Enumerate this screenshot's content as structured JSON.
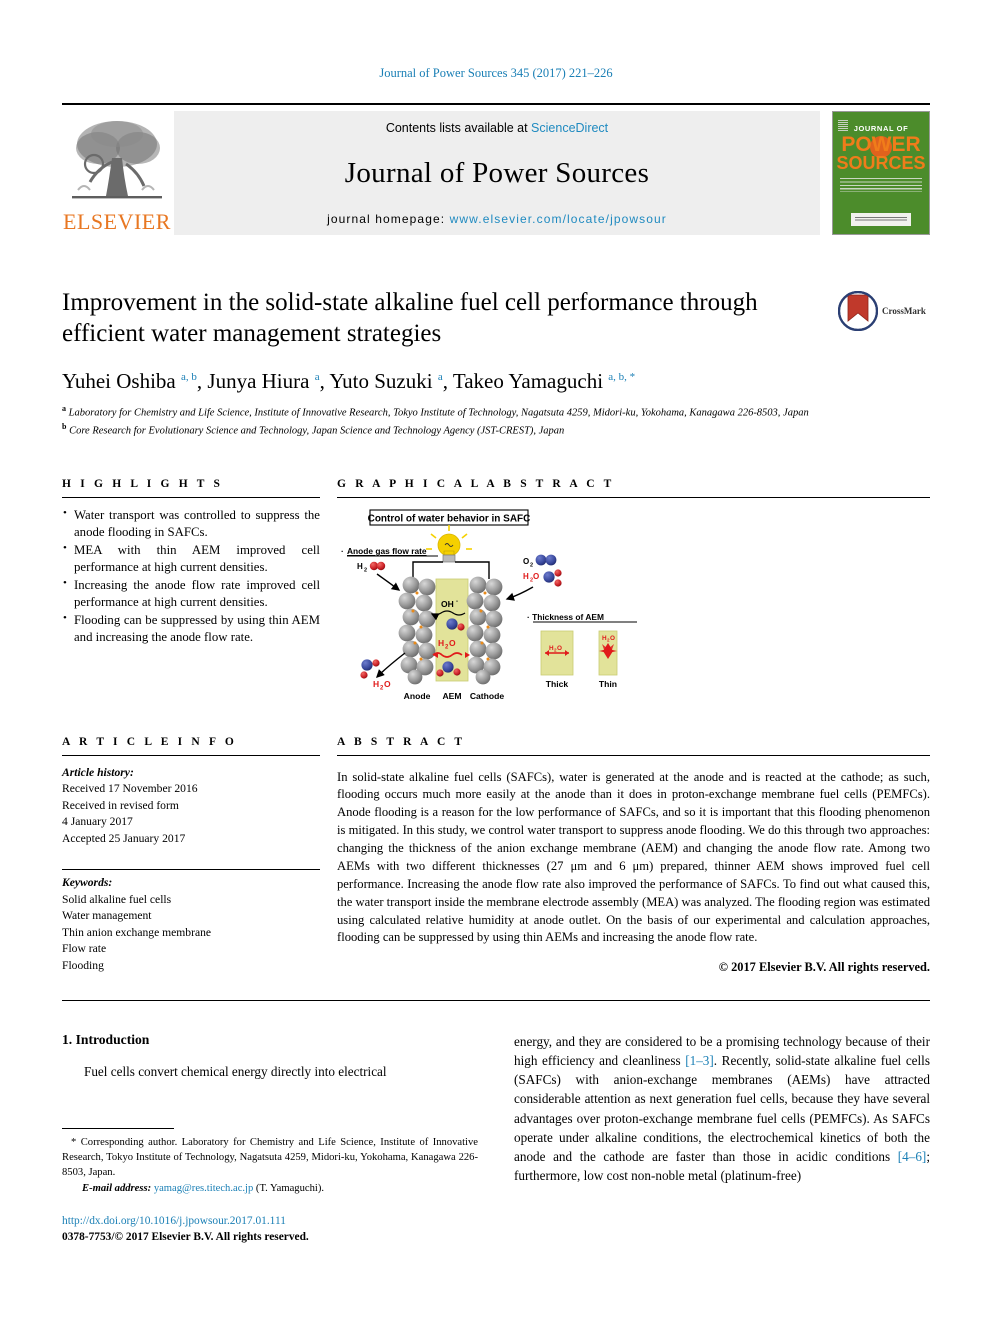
{
  "running_head": "Journal of Power Sources 345 (2017) 221–226",
  "masthead": {
    "publisher_name": "ELSEVIER",
    "contents_prefix": "Contents lists available at ",
    "contents_link": "ScienceDirect",
    "journal_name": "Journal of Power Sources",
    "homepage_prefix": "journal homepage: ",
    "homepage_url": "www.elsevier.com/locate/jpowsour",
    "cover": {
      "line1": "JOURNAL OF",
      "line2": "POWER",
      "line3": "SOURCES",
      "bg_color": "#4c8c2b",
      "accent_color": "#f07c1a"
    }
  },
  "title": "Improvement in the solid-state alkaline fuel cell performance through efficient water management strategies",
  "crossmark_label": "CrossMark",
  "authors": [
    {
      "name": "Yuhei Oshiba",
      "marks": "a, b",
      "sep": ", "
    },
    {
      "name": "Junya Hiura",
      "marks": "a",
      "sep": ", "
    },
    {
      "name": "Yuto Suzuki",
      "marks": "a",
      "sep": ", "
    },
    {
      "name": "Takeo Yamaguchi",
      "marks": "a, b, *",
      "sep": ""
    }
  ],
  "affiliations": [
    {
      "mark": "a",
      "text": "Laboratory for Chemistry and Life Science, Institute of Innovative Research, Tokyo Institute of Technology, Nagatsuta 4259, Midori-ku, Yokohama, Kanagawa 226-8503, Japan"
    },
    {
      "mark": "b",
      "text": "Core Research for Evolutionary Science and Technology, Japan Science and Technology Agency (JST-CREST), Japan"
    }
  ],
  "highlights": {
    "heading": "H I G H L I G H T S",
    "items": [
      "Water transport was controlled to suppress the anode flooding in SAFCs.",
      "MEA with thin AEM improved cell performance at high current densities.",
      "Increasing the anode flow rate improved cell performance at high current densities.",
      "Flooding can be suppressed by using thin AEM and increasing the anode flow rate."
    ]
  },
  "graphical_abstract": {
    "heading": "G R A P H I C A L   A B S T R A C T",
    "figure_title": "Control of water behavior in SAFC",
    "label_anode_flow": "· Anode gas flow rate",
    "label_thickness": "· Thickness of AEM",
    "label_h2": "H₂",
    "label_o2": "O₂",
    "label_h2o": "H₂O",
    "label_oh": "OH⁻",
    "label_anode": "Anode",
    "label_aem": "AEM",
    "label_cathode": "Cathode",
    "label_thick": "Thick",
    "label_thin": "Thin",
    "colors": {
      "membrane": "#e2e39a",
      "particle": "#9a9a9a",
      "oxygen_atom": "#3b4a9c",
      "hydrogen_atom": "#cc2026",
      "water_text": "#e01b1b",
      "bulb": "#f5d000"
    }
  },
  "article_info": {
    "heading": "A R T I C L E   I N F O",
    "history_label": "Article history:",
    "history_lines": [
      "Received 17 November 2016",
      "Received in revised form",
      "4 January 2017",
      "Accepted 25 January 2017"
    ],
    "keywords_label": "Keywords:",
    "keywords": [
      "Solid alkaline fuel cells",
      "Water management",
      "Thin anion exchange membrane",
      "Flow rate",
      "Flooding"
    ]
  },
  "abstract": {
    "heading": "A B S T R A C T",
    "text": "In solid-state alkaline fuel cells (SAFCs), water is generated at the anode and is reacted at the cathode; as such, flooding occurs much more easily at the anode than it does in proton-exchange membrane fuel cells (PEMFCs). Anode flooding is a reason for the low performance of SAFCs, and so it is important that this flooding phenomenon is mitigated. In this study, we control water transport to suppress anode flooding. We do this through two approaches: changing the thickness of the anion exchange membrane (AEM) and changing the anode flow rate. Among two AEMs with two different thicknesses (27 μm and 6 μm) prepared, thinner AEM shows improved fuel cell performance. Increasing the anode flow rate also improved the performance of SAFCs. To find out what caused this, the water transport inside the membrane electrode assembly (MEA) was analyzed. The flooding region was estimated using calculated relative humidity at anode outlet. On the basis of our experimental and calculation approaches, flooding can be suppressed by using thin AEMs and increasing the anode flow rate.",
    "copyright": "© 2017 Elsevier B.V. All rights reserved."
  },
  "body": {
    "section_number_title": "1. Introduction",
    "paragraph_left": "Fuel cells convert chemical energy directly into electrical",
    "paragraph_right_part1": "energy, and they are considered to be a promising technology because of their high efficiency and cleanliness ",
    "ref_1_3": "[1–3]",
    "paragraph_right_part2": ". Recently, solid-state alkaline fuel cells (SAFCs) with anion-exchange membranes (AEMs) have attracted considerable attention as next generation fuel cells, because they have several advantages over proton-exchange membrane fuel cells (PEMFCs). As SAFCs operate under alkaline conditions, the electrochemical kinetics of both the anode and the cathode are faster than those in acidic conditions ",
    "ref_4_6": "[4–6]",
    "paragraph_right_part3": "; furthermore, low cost non-noble metal (platinum-free)"
  },
  "footnote": {
    "text": "* Corresponding author. Laboratory for Chemistry and Life Science, Institute of Innovative Research, Tokyo Institute of Technology, Nagatsuta 4259, Midori-ku, Yokohama, Kanagawa 226-8503, Japan.",
    "email_label": "E-mail address: ",
    "email": "yamag@res.titech.ac.jp",
    "email_suffix": " (T. Yamaguchi)."
  },
  "doi": {
    "url": "http://dx.doi.org/10.1016/j.jpowsour.2017.01.111",
    "issn_line": "0378-7753/© 2017 Elsevier B.V. All rights reserved."
  }
}
